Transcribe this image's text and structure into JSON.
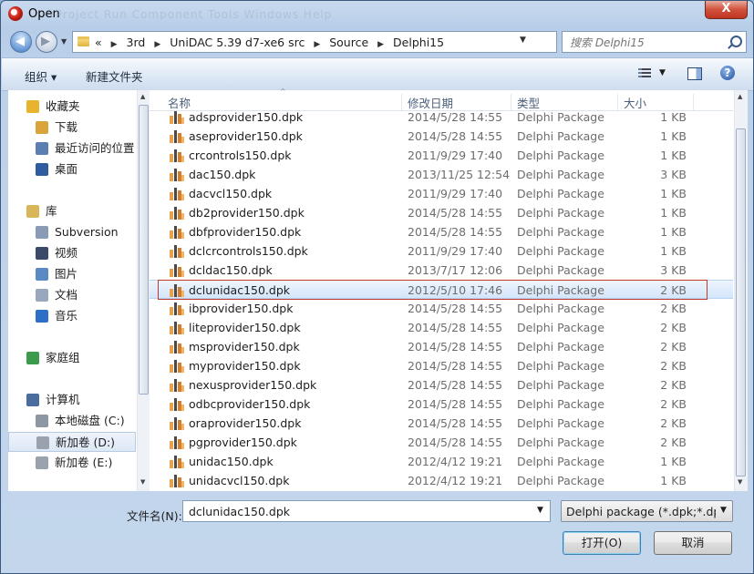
{
  "window": {
    "title": "Open",
    "ghost_menu": "Project   Run   Component   Tools   Windows   Help",
    "close_glyph": "X"
  },
  "address": {
    "overflow": "«",
    "crumbs": [
      "3rd",
      "UniDAC 5.39 d7-xe6 src",
      "Source",
      "Delphi15"
    ],
    "separator": "▶"
  },
  "search": {
    "placeholder": "搜索 Delphi15"
  },
  "toolbar": {
    "organize_label": "组织 ▾",
    "new_folder_label": "新建文件夹",
    "help_glyph": "?"
  },
  "nav": {
    "items": [
      {
        "label": "收藏夹",
        "icon": "star-icon",
        "color": "#e8b430"
      },
      {
        "label": "下载",
        "icon": "download-folder-icon",
        "color": "#d9a43a"
      },
      {
        "label": "最近访问的位置",
        "icon": "recent-places-icon",
        "color": "#5c7fb2"
      },
      {
        "label": "桌面",
        "icon": "desktop-icon",
        "color": "#2f5c9e"
      },
      {
        "label": "库",
        "icon": "library-icon",
        "color": "#d9b65a"
      },
      {
        "label": "Subversion",
        "icon": "library-folder-icon",
        "color": "#8a9bb5"
      },
      {
        "label": "视频",
        "icon": "video-icon",
        "color": "#3c4a6a"
      },
      {
        "label": "图片",
        "icon": "pictures-icon",
        "color": "#5a8ac4"
      },
      {
        "label": "文档",
        "icon": "documents-icon",
        "color": "#9aa8bd"
      },
      {
        "label": "音乐",
        "icon": "music-icon",
        "color": "#2d6fc7"
      },
      {
        "label": "家庭组",
        "icon": "homegroup-icon",
        "color": "#3c9a4c"
      },
      {
        "label": "计算机",
        "icon": "computer-icon",
        "color": "#4a6d9e"
      },
      {
        "label": "本地磁盘 (C:)",
        "icon": "system-drive-icon",
        "color": "#8d96a3"
      },
      {
        "label": "新加卷 (D:)",
        "icon": "drive-icon",
        "color": "#9aa2ad"
      },
      {
        "label": "新加卷 (E:)",
        "icon": "drive-icon",
        "color": "#9aa2ad"
      }
    ]
  },
  "files": {
    "columns": {
      "name": "名称",
      "date": "修改日期",
      "type": "类型",
      "size": "大小"
    },
    "rows": [
      {
        "name": "adsprovider150.dpk",
        "date": "2014/5/28 14:55",
        "type": "Delphi Package",
        "size": "1 KB"
      },
      {
        "name": "aseprovider150.dpk",
        "date": "2014/5/28 14:55",
        "type": "Delphi Package",
        "size": "1 KB"
      },
      {
        "name": "crcontrols150.dpk",
        "date": "2011/9/29 17:40",
        "type": "Delphi Package",
        "size": "1 KB"
      },
      {
        "name": "dac150.dpk",
        "date": "2013/11/25 12:54",
        "type": "Delphi Package",
        "size": "3 KB"
      },
      {
        "name": "dacvcl150.dpk",
        "date": "2011/9/29 17:40",
        "type": "Delphi Package",
        "size": "1 KB"
      },
      {
        "name": "db2provider150.dpk",
        "date": "2014/5/28 14:55",
        "type": "Delphi Package",
        "size": "1 KB"
      },
      {
        "name": "dbfprovider150.dpk",
        "date": "2014/5/28 14:55",
        "type": "Delphi Package",
        "size": "1 KB"
      },
      {
        "name": "dclcrcontrols150.dpk",
        "date": "2011/9/29 17:40",
        "type": "Delphi Package",
        "size": "1 KB"
      },
      {
        "name": "dcldac150.dpk",
        "date": "2013/7/17 12:06",
        "type": "Delphi Package",
        "size": "3 KB"
      },
      {
        "name": "dclunidac150.dpk",
        "date": "2012/5/10 17:46",
        "type": "Delphi Package",
        "size": "2 KB"
      },
      {
        "name": "ibprovider150.dpk",
        "date": "2014/5/28 14:55",
        "type": "Delphi Package",
        "size": "2 KB"
      },
      {
        "name": "liteprovider150.dpk",
        "date": "2014/5/28 14:55",
        "type": "Delphi Package",
        "size": "2 KB"
      },
      {
        "name": "msprovider150.dpk",
        "date": "2014/5/28 14:55",
        "type": "Delphi Package",
        "size": "2 KB"
      },
      {
        "name": "myprovider150.dpk",
        "date": "2014/5/28 14:55",
        "type": "Delphi Package",
        "size": "2 KB"
      },
      {
        "name": "nexusprovider150.dpk",
        "date": "2014/5/28 14:55",
        "type": "Delphi Package",
        "size": "2 KB"
      },
      {
        "name": "odbcprovider150.dpk",
        "date": "2014/5/28 14:55",
        "type": "Delphi Package",
        "size": "2 KB"
      },
      {
        "name": "oraprovider150.dpk",
        "date": "2014/5/28 14:55",
        "type": "Delphi Package",
        "size": "2 KB"
      },
      {
        "name": "pgprovider150.dpk",
        "date": "2014/5/28 14:55",
        "type": "Delphi Package",
        "size": "2 KB"
      },
      {
        "name": "unidac150.dpk",
        "date": "2012/4/12 19:21",
        "type": "Delphi Package",
        "size": "1 KB"
      },
      {
        "name": "unidacvcl150.dpk",
        "date": "2012/4/12 19:21",
        "type": "Delphi Package",
        "size": "1 KB"
      }
    ],
    "selected": "dclunidac150.dpk"
  },
  "footer": {
    "filename_label": "文件名(N):",
    "filename_value": "dclunidac150.dpk",
    "filetype_value": "Delphi package (*.dpk;*.dpk",
    "open_label": "打开(O)",
    "cancel_label": "取消"
  },
  "colors": {
    "selection_outline": "#c0392b",
    "accent": "#3c7fb1"
  }
}
